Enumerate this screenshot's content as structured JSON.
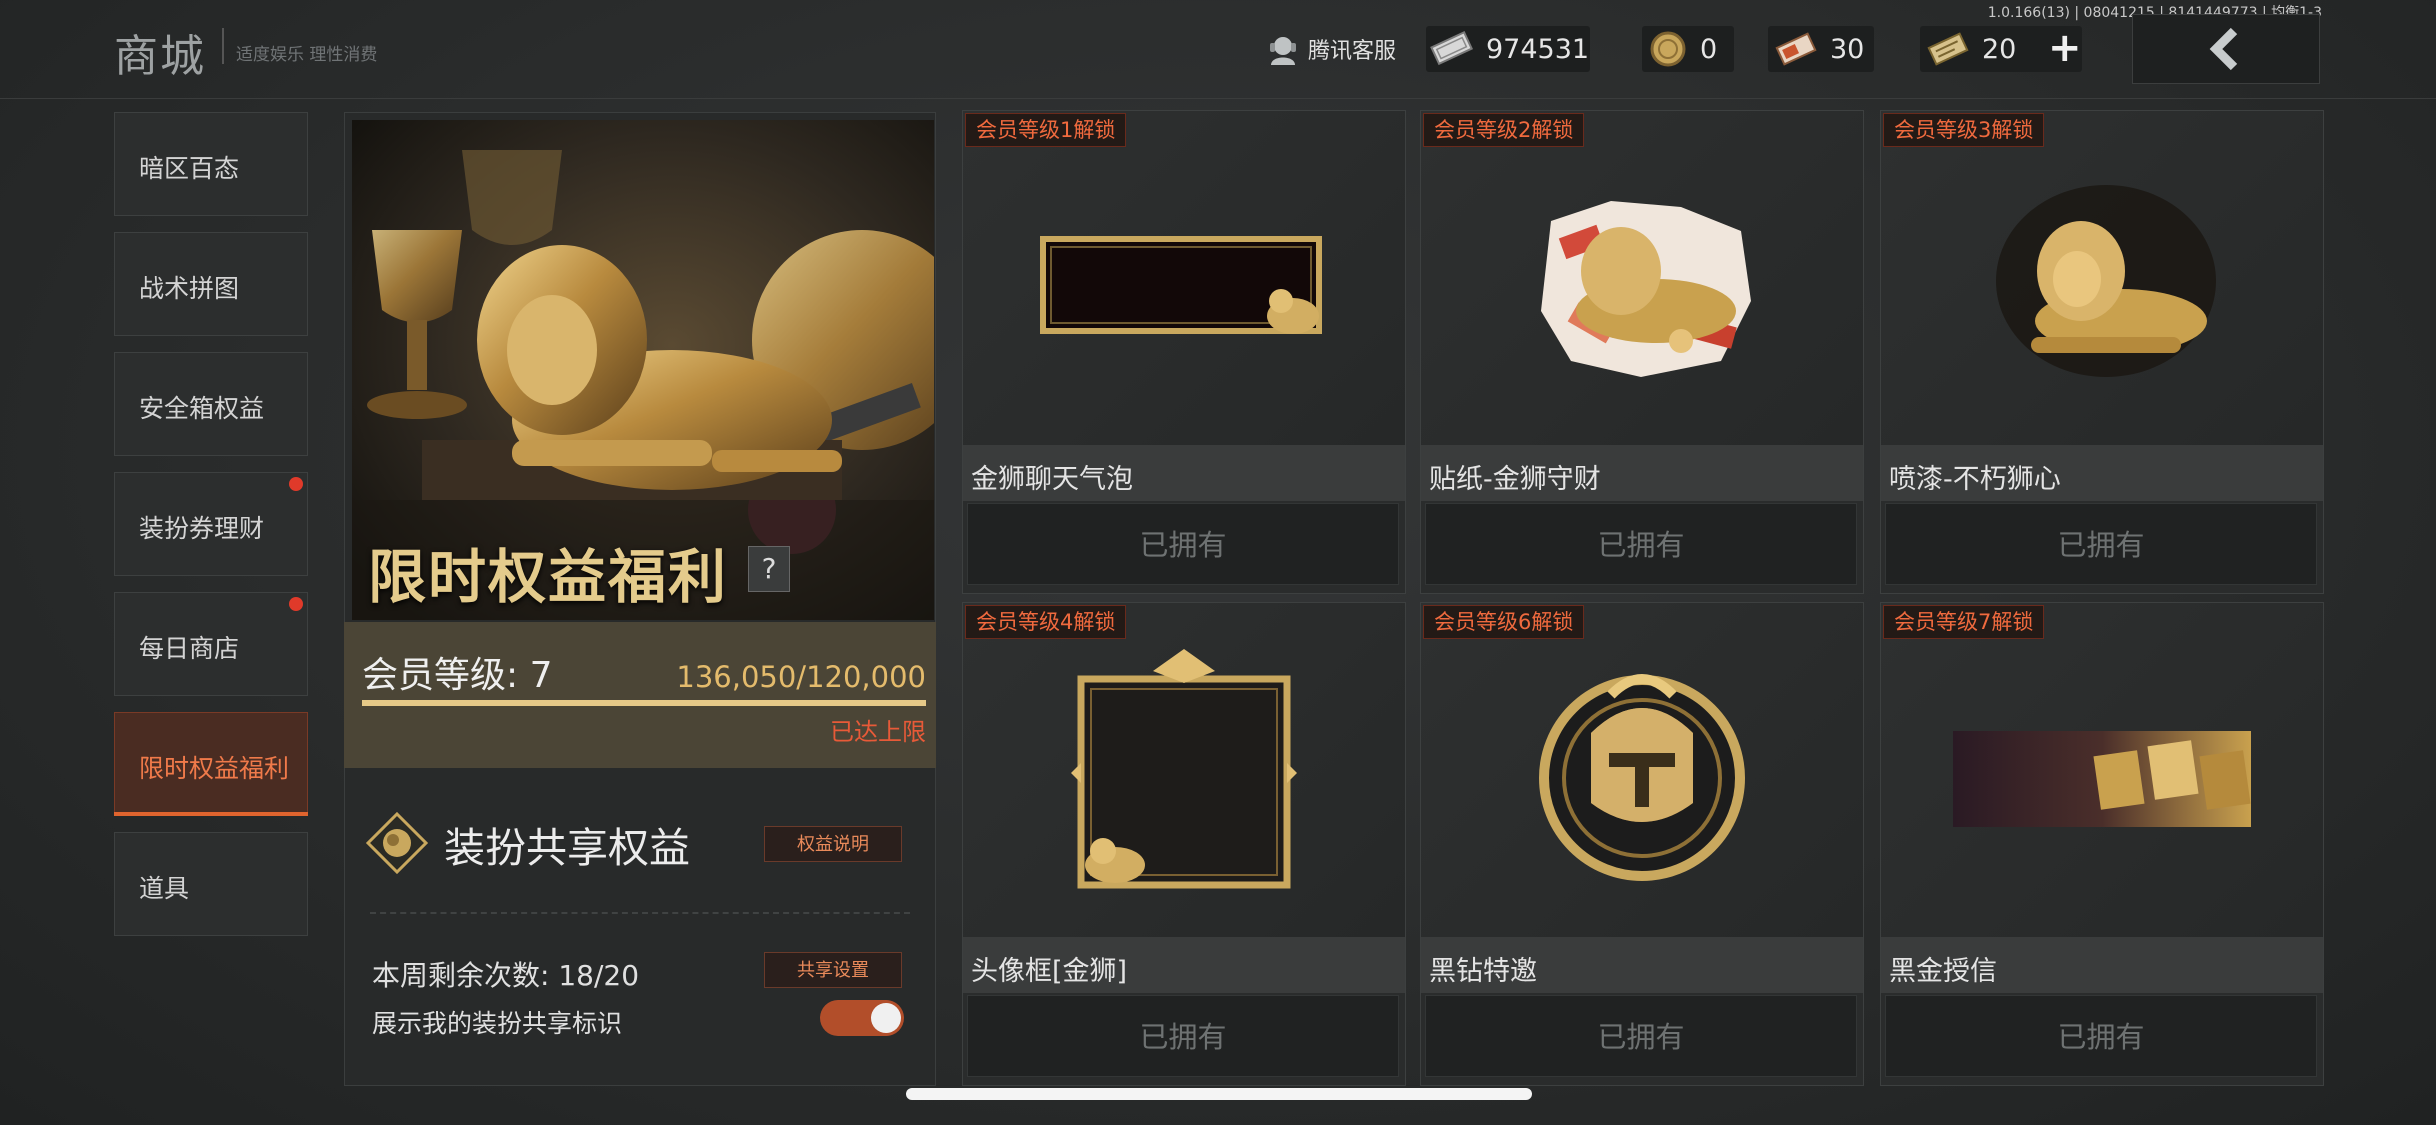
{
  "header": {
    "title": "商城",
    "subtitle": "适度娱乐 理性消费",
    "version": "1.0.166(13) | 08041215 | 8141449773 | 均衡1-3",
    "customer_service": "腾讯客服",
    "currencies": [
      {
        "icon": "banknote-icon",
        "value": "974531"
      },
      {
        "icon": "gold-coin-icon",
        "value": "0"
      },
      {
        "icon": "coupon-ticket-icon",
        "value": "30"
      },
      {
        "icon": "voucher-icon",
        "value": "20"
      }
    ],
    "add_label": "+",
    "back_icon": "chevron-left-icon"
  },
  "sidebar": {
    "items": [
      {
        "label": "暗区百态",
        "badge": false,
        "active": false
      },
      {
        "label": "战术拼图",
        "badge": false,
        "active": false
      },
      {
        "label": "安全箱权益",
        "badge": false,
        "active": false
      },
      {
        "label": "装扮券理财",
        "badge": true,
        "active": false
      },
      {
        "label": "每日商店",
        "badge": true,
        "active": false
      },
      {
        "label": "限时权益福利",
        "badge": false,
        "active": true
      },
      {
        "label": "道具",
        "badge": false,
        "active": false
      }
    ]
  },
  "feature": {
    "banner_title": "限时权益福利",
    "help_label": "?",
    "level_label": "会员等级: 7",
    "points": "136,050/120,000",
    "progress_fraction": 1.0,
    "max_label": "已达上限",
    "share_title": "装扮共享权益",
    "rules_button": "权益说明",
    "remaining": "本周剩余次数: 18/20",
    "share_settings_button": "共享设置",
    "show_mark_label": "展示我的装扮共享标识",
    "show_mark_on": true
  },
  "rewards": [
    {
      "tag": "会员等级1解锁",
      "name": "金狮聊天气泡",
      "status": "已拥有"
    },
    {
      "tag": "会员等级2解锁",
      "name": "贴纸-金狮守财",
      "status": "已拥有"
    },
    {
      "tag": "会员等级3解锁",
      "name": "喷漆-不朽狮心",
      "status": "已拥有"
    },
    {
      "tag": "会员等级4解锁",
      "name": "头像框[金狮]",
      "status": "已拥有"
    },
    {
      "tag": "会员等级6解锁",
      "name": "黑钻特邀",
      "status": "已拥有"
    },
    {
      "tag": "会员等级7解锁",
      "name": "黑金授信",
      "status": "已拥有"
    }
  ],
  "colors": {
    "accent": "#e0642e",
    "gold": "#e4cb8c",
    "owned_text": "#6e7272"
  }
}
